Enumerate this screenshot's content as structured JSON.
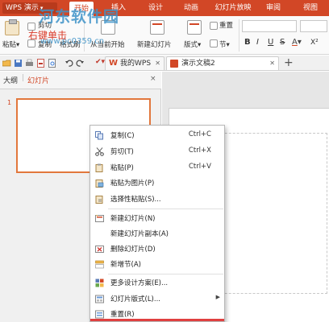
{
  "app": {
    "logo": "WPS 演示",
    "watermark": "河东软件园",
    "watermark_url": "www.pc0359.cn"
  },
  "ribbon_tabs": [
    "开始",
    "插入",
    "设计",
    "动画",
    "幻灯片放映",
    "审阅",
    "视图"
  ],
  "ribbon_active_tab": "开始",
  "ribbon": {
    "paste": "粘贴",
    "cut": "剪切",
    "copy": "复制",
    "format_painter": "格式刷",
    "from_current": "从当前开始",
    "new_slide": "新建幻灯片",
    "layout": "版式",
    "reset": "重置",
    "section": "节",
    "bold": "B",
    "italic": "I",
    "underline": "U",
    "strikethrough": "S",
    "font_color": "A",
    "superscript": "X²"
  },
  "doc_tabs": [
    {
      "label": "我的WPS",
      "active": false
    },
    {
      "label": "演示文稿2",
      "active": true
    }
  ],
  "left_panel": {
    "tabs": [
      "大纲",
      "幻灯片"
    ],
    "active_tab": "幻灯片",
    "close": "×",
    "slide_number": "1",
    "thumbnail_text": "右键单击"
  },
  "context_menu": {
    "items": [
      {
        "label": "复制(C)",
        "shortcut": "Ctrl+C",
        "icon": "copy-icon"
      },
      {
        "label": "剪切(T)",
        "shortcut": "Ctrl+X",
        "icon": "scissors-icon"
      },
      {
        "label": "粘贴(P)",
        "shortcut": "Ctrl+V",
        "icon": "paste-icon"
      },
      {
        "label": "粘贴为图片(P)",
        "shortcut": "",
        "icon": "paste-picture-icon"
      },
      {
        "label": "选择性粘贴(S)...",
        "shortcut": "",
        "icon": "paste-special-icon"
      },
      {
        "label": "新建幻灯片(N)",
        "shortcut": "",
        "icon": "new-slide-icon"
      },
      {
        "label": "新建幻灯片副本(A)",
        "shortcut": "",
        "icon": ""
      },
      {
        "label": "删除幻灯片(D)",
        "shortcut": "",
        "icon": "delete-slide-icon"
      },
      {
        "label": "新增节(A)",
        "shortcut": "",
        "icon": "new-section-icon"
      },
      {
        "label": "更多设计方案(E)...",
        "shortcut": "",
        "icon": "design-icon"
      },
      {
        "label": "幻灯片版式(L)...",
        "shortcut": "",
        "icon": "layout-icon",
        "submenu": true
      },
      {
        "label": "重置(R)",
        "shortcut": "",
        "icon": "reset-icon"
      }
    ]
  },
  "colors": {
    "accent": "#d24726",
    "selection": "#e2773c",
    "thumbnail_text": "#d93a2a",
    "watermark": "#3f93c8"
  }
}
